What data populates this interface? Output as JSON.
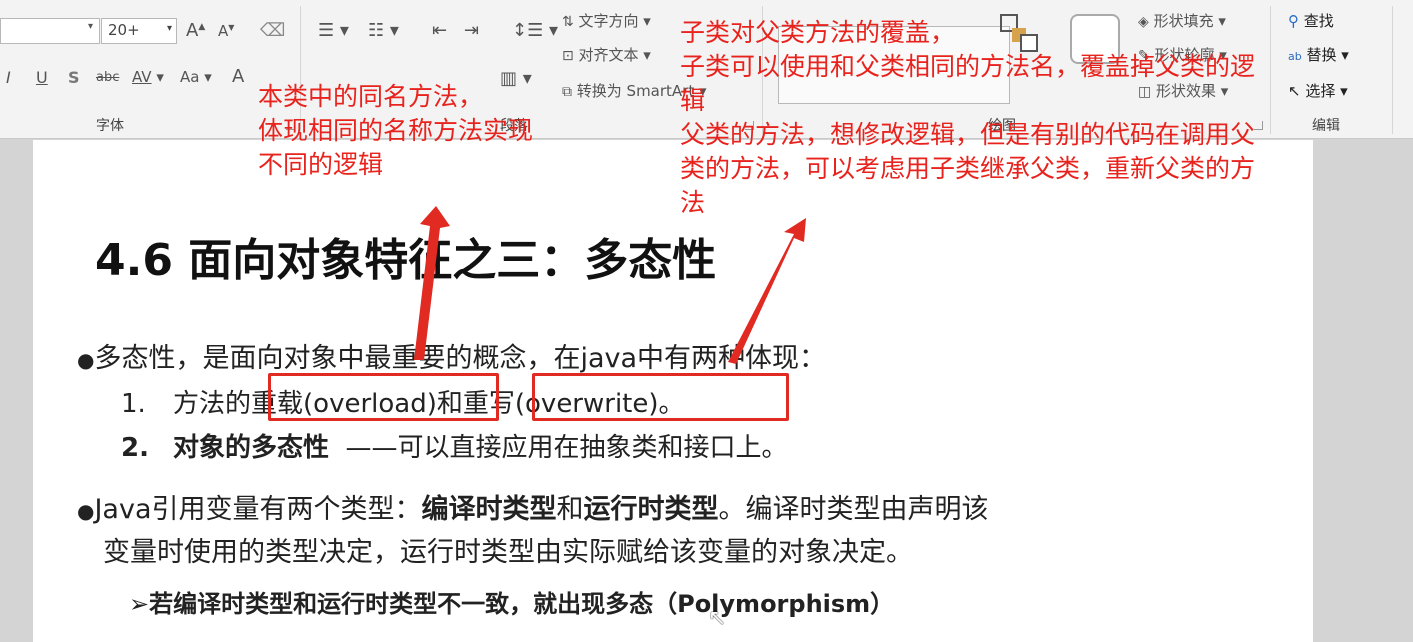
{
  "ribbon": {
    "font_size_value": "20+",
    "grow_font": "A",
    "shrink_font": "A",
    "italic": "I",
    "underline": "U",
    "shadow": "S",
    "strike": "abc",
    "spacing": "AV",
    "case": "Aa",
    "text_direction": "文字方向",
    "align_text": "对齐文本",
    "convert_smartart": "转换为 SmartArt",
    "shape_fill": "形状填充",
    "shape_outline": "形状轮廓",
    "shape_effects": "形状效果",
    "find": "查找",
    "replace": "替换",
    "select": "选择",
    "groups": {
      "font": "字体",
      "paragraph": "段落",
      "drawing": "绘图",
      "editing": "编辑"
    }
  },
  "slide": {
    "title": "4.6  面向对象特征之三：多态性",
    "bullet1": "多态性，是面向对象中最重要的概念，在java中有两种体现：",
    "item1_num": "1.",
    "item1_pre": "方法的",
    "item1_overload": "重载(overload)",
    "item1_mid": "和",
    "item1_override": "重写(overwrite)。",
    "item2_num": "2.",
    "item2_bold": "对象的多态性",
    "item2_rest": "——可以直接应用在抽象类和接口上。",
    "bullet2_pre": "Java引用变量有两个类型：",
    "bullet2_b1": "编译时类型",
    "bullet2_mid": "和",
    "bullet2_b2": "运行时类型",
    "bullet2_rest": "。编译时类型由声明该",
    "bullet2_line2": "变量时使用的类型决定，运行时类型由实际赋给该变量的对象决定。",
    "sub_arrow": "➢",
    "sub_text": "若编译时类型和运行时类型不一致，就出现多态（Polymorphism）"
  },
  "annotations": {
    "left": [
      "本类中的同名方法，",
      "体现相同的名称方法实现",
      "不同的逻辑"
    ],
    "right": [
      "子类对父类方法的覆盖，",
      "子类可以使用和父类相同的方法名，覆盖掉父类的逻",
      "辑",
      "父类的方法，想修改逻辑，但是有别的代码在调用父",
      "类的方法，可以考虑用子类继承父类，重新父类的方",
      "法"
    ]
  },
  "colors": {
    "annotation": "#e8231d",
    "box": "#e02a22",
    "ribbon_bg": "#f3f3f3"
  }
}
